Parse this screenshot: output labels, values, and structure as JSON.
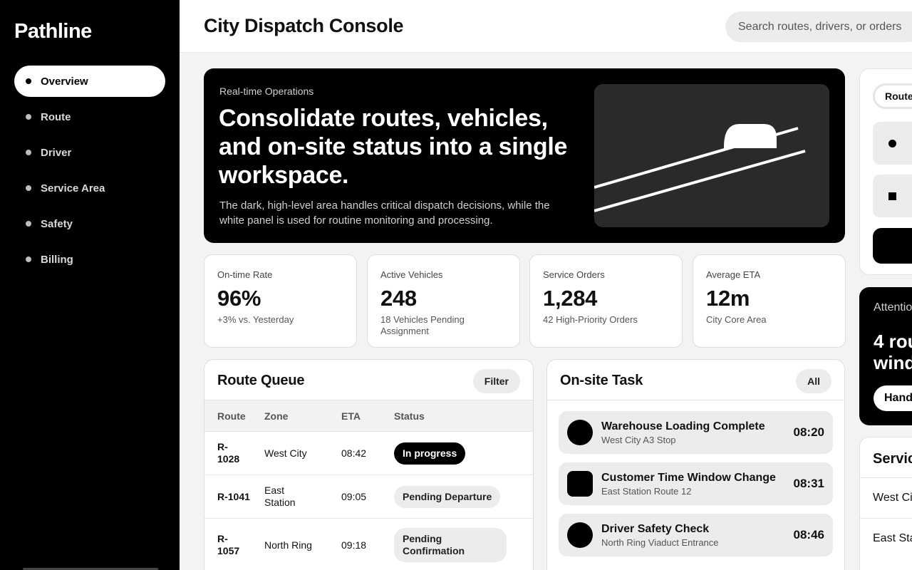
{
  "sidebar": {
    "brand": "Pathline",
    "items": [
      {
        "label": "Overview"
      },
      {
        "label": "Route"
      },
      {
        "label": "Driver"
      },
      {
        "label": "Service Area"
      },
      {
        "label": "Safety"
      },
      {
        "label": "Billing"
      }
    ],
    "active_index": 0
  },
  "header": {
    "title": "City Dispatch Console",
    "search_placeholder": "Search routes, drivers, or orders"
  },
  "hero": {
    "eyebrow": "Real-time Operations",
    "headline": "Consolidate routes, vehicles, and on-site status into a single workspace.",
    "description": "The dark, high-level area handles critical dispatch decisions, while the white panel is used for routine monitoring and processing."
  },
  "kpis": [
    {
      "label": "On-time Rate",
      "value": "96%",
      "sub": "+3% vs. Yesterday"
    },
    {
      "label": "Active Vehicles",
      "value": "248",
      "sub": "18 Vehicles Pending Assignment"
    },
    {
      "label": "Service Orders",
      "value": "1,284",
      "sub": "42 High-Priority Orders"
    },
    {
      "label": "Average ETA",
      "value": "12m",
      "sub": "City Core Area"
    }
  ],
  "route_queue": {
    "title": "Route Queue",
    "filter_label": "Filter",
    "columns": [
      "Route",
      "Zone",
      "ETA",
      "Status"
    ],
    "rows": [
      {
        "route": "R-1028",
        "zone": "West City",
        "eta": "08:42",
        "status": "In progress"
      },
      {
        "route": "R-1041",
        "zone": "East Station",
        "eta": "09:05",
        "status": "Pending Departure"
      },
      {
        "route": "R-1057",
        "zone": "North Ring",
        "eta": "09:18",
        "status": "Pending Confirmation"
      }
    ]
  },
  "onsite": {
    "title": "On-site Task",
    "all_label": "All",
    "tasks": [
      {
        "title": "Warehouse Loading Complete",
        "sub": "West City A3 Stop",
        "time": "08:20",
        "marker": "circle"
      },
      {
        "title": "Customer Time Window Change",
        "sub": "East Station Route 12",
        "time": "08:31",
        "marker": "square"
      },
      {
        "title": "Driver Safety Check",
        "sub": "North Ring Viaduct Entrance",
        "time": "08:46",
        "marker": "circle"
      }
    ]
  },
  "right_panel": {
    "tab_label": "Route",
    "attention_label": "Attention",
    "attention_title_line1": "4 rou",
    "attention_title_line2": "wind",
    "attention_button": "Hand",
    "service_title": "Servic",
    "service_rows": [
      "West Ci",
      "East Sta"
    ]
  },
  "colors": {
    "sidebar_bg": "#000000",
    "hero_bg": "#000000",
    "accent": "#000000",
    "pill_bg": "#ececec"
  }
}
